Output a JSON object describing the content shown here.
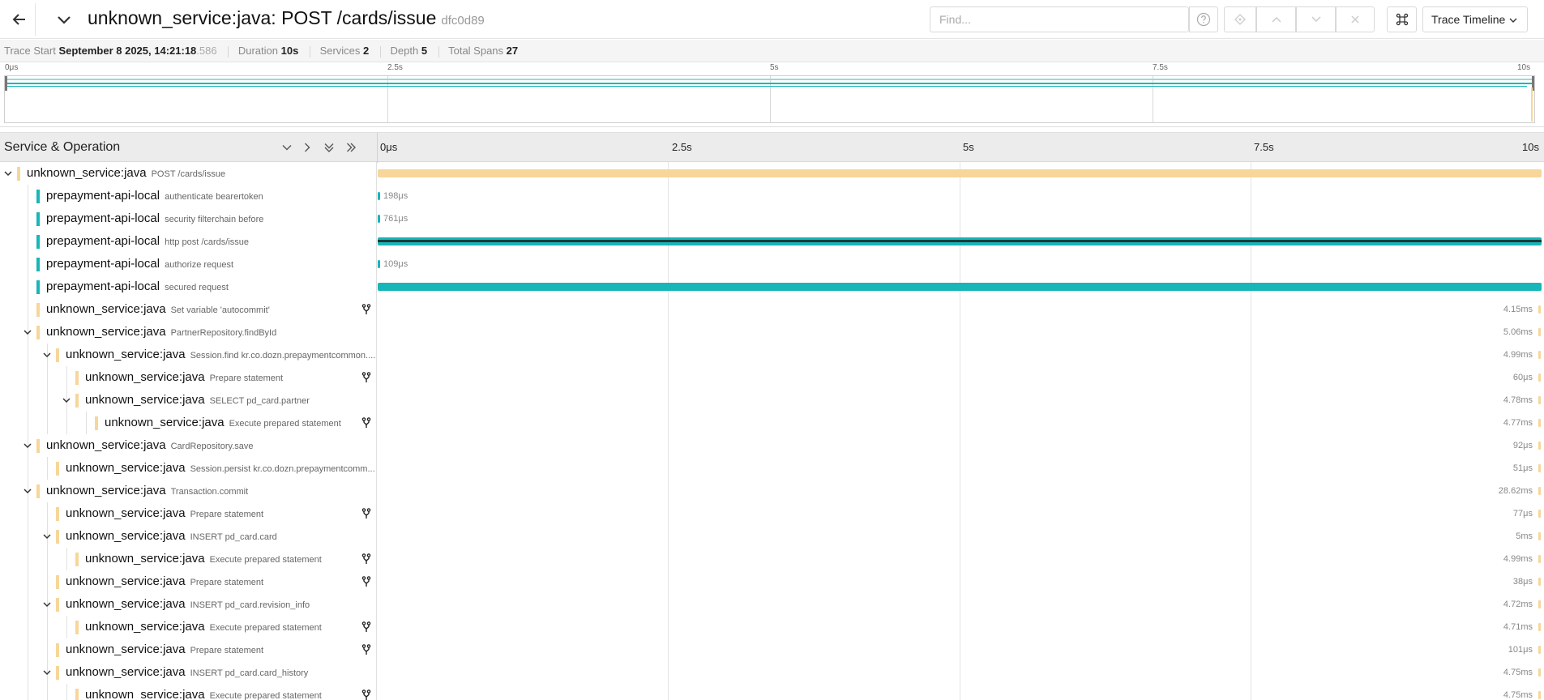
{
  "colors": {
    "java": "#f7d699",
    "prepay": "#17b6b8",
    "accent_dark": "#1e3a3a"
  },
  "header": {
    "title": "unknown_service:java: POST /cards/issue",
    "trace_id": "dfc0d89",
    "find_placeholder": "Find...",
    "view_label": "Trace Timeline",
    "icons": [
      "arrow-left-icon",
      "chevron-down-icon",
      "question-icon",
      "locate-icon",
      "arrow-up-icon",
      "arrow-down-icon",
      "close-icon",
      "command-icon"
    ]
  },
  "summary": {
    "trace_start_label": "Trace Start",
    "trace_start_value": "September 8 2025, 14:21:18",
    "trace_start_ms": ".586",
    "duration_label": "Duration",
    "duration_value": "10s",
    "services_label": "Services",
    "services_value": "2",
    "depth_label": "Depth",
    "depth_value": "5",
    "total_spans_label": "Total Spans",
    "total_spans_value": "27"
  },
  "minimap": {
    "ticks": [
      "0μs",
      "2.5s",
      "5s",
      "7.5s",
      "10s"
    ]
  },
  "timeline": {
    "column_title": "Service & Operation",
    "ticks": [
      "0μs",
      "2.5s",
      "5s",
      "7.5s",
      "10s"
    ]
  },
  "spans": [
    {
      "service": "unknown_service:java",
      "operation": "POST /cards/issue",
      "depth": 0,
      "expanded": true,
      "svc": "java",
      "bar": {
        "start": 0,
        "end": 1.0
      },
      "label": "",
      "fork": false
    },
    {
      "service": "prepayment-api-local",
      "operation": "authenticate bearertoken",
      "depth": 1,
      "expanded": null,
      "svc": "prepay",
      "bar": {
        "start": 0,
        "end": 0.0006
      },
      "label": "198μs",
      "fork": false
    },
    {
      "service": "prepayment-api-local",
      "operation": "security filterchain before",
      "depth": 1,
      "expanded": null,
      "svc": "prepay",
      "bar": {
        "start": 0,
        "end": 0.0006
      },
      "label": "761μs",
      "fork": false
    },
    {
      "service": "prepayment-api-local",
      "operation": "http post /cards/issue",
      "depth": 1,
      "expanded": null,
      "svc": "prepay",
      "bar": {
        "start": 0,
        "end": 1.0
      },
      "label": "",
      "fork": false,
      "dark_line": true
    },
    {
      "service": "prepayment-api-local",
      "operation": "authorize request",
      "depth": 1,
      "expanded": null,
      "svc": "prepay",
      "bar": {
        "start": 0,
        "end": 0.0006
      },
      "label": "109μs",
      "fork": false
    },
    {
      "service": "prepayment-api-local",
      "operation": "secured request",
      "depth": 1,
      "expanded": null,
      "svc": "prepay",
      "bar": {
        "start": 0,
        "end": 1.0
      },
      "label": "",
      "fork": false
    },
    {
      "service": "unknown_service:java",
      "operation": "Set variable 'autocommit'",
      "depth": 1,
      "expanded": null,
      "svc": "java",
      "bar": null,
      "label": "4.15ms",
      "fork": true
    },
    {
      "service": "unknown_service:java",
      "operation": "PartnerRepository.findById",
      "depth": 1,
      "expanded": true,
      "svc": "java",
      "bar": null,
      "label": "5.06ms",
      "fork": false
    },
    {
      "service": "unknown_service:java",
      "operation": "Session.find kr.co.dozn.prepaymentcommon....",
      "depth": 2,
      "expanded": true,
      "svc": "java",
      "bar": null,
      "label": "4.99ms",
      "fork": false
    },
    {
      "service": "unknown_service:java",
      "operation": "Prepare statement",
      "depth": 3,
      "expanded": null,
      "svc": "java",
      "bar": null,
      "label": "60μs",
      "fork": true
    },
    {
      "service": "unknown_service:java",
      "operation": "SELECT pd_card.partner",
      "depth": 3,
      "expanded": true,
      "svc": "java",
      "bar": null,
      "label": "4.78ms",
      "fork": false
    },
    {
      "service": "unknown_service:java",
      "operation": "Execute prepared statement",
      "depth": 4,
      "expanded": null,
      "svc": "java",
      "bar": null,
      "label": "4.77ms",
      "fork": true
    },
    {
      "service": "unknown_service:java",
      "operation": "CardRepository.save",
      "depth": 1,
      "expanded": true,
      "svc": "java",
      "bar": null,
      "label": "92μs",
      "fork": false
    },
    {
      "service": "unknown_service:java",
      "operation": "Session.persist kr.co.dozn.prepaymentcomm...",
      "depth": 2,
      "expanded": null,
      "svc": "java",
      "bar": null,
      "label": "51μs",
      "fork": false
    },
    {
      "service": "unknown_service:java",
      "operation": "Transaction.commit",
      "depth": 1,
      "expanded": true,
      "svc": "java",
      "bar": null,
      "label": "28.62ms",
      "fork": false
    },
    {
      "service": "unknown_service:java",
      "operation": "Prepare statement",
      "depth": 2,
      "expanded": null,
      "svc": "java",
      "bar": null,
      "label": "77μs",
      "fork": true
    },
    {
      "service": "unknown_service:java",
      "operation": "INSERT pd_card.card",
      "depth": 2,
      "expanded": true,
      "svc": "java",
      "bar": null,
      "label": "5ms",
      "fork": false
    },
    {
      "service": "unknown_service:java",
      "operation": "Execute prepared statement",
      "depth": 3,
      "expanded": null,
      "svc": "java",
      "bar": null,
      "label": "4.99ms",
      "fork": true
    },
    {
      "service": "unknown_service:java",
      "operation": "Prepare statement",
      "depth": 2,
      "expanded": null,
      "svc": "java",
      "bar": null,
      "label": "38μs",
      "fork": true
    },
    {
      "service": "unknown_service:java",
      "operation": "INSERT pd_card.revision_info",
      "depth": 2,
      "expanded": true,
      "svc": "java",
      "bar": null,
      "label": "4.72ms",
      "fork": false
    },
    {
      "service": "unknown_service:java",
      "operation": "Execute prepared statement",
      "depth": 3,
      "expanded": null,
      "svc": "java",
      "bar": null,
      "label": "4.71ms",
      "fork": true
    },
    {
      "service": "unknown_service:java",
      "operation": "Prepare statement",
      "depth": 2,
      "expanded": null,
      "svc": "java",
      "bar": null,
      "label": "101μs",
      "fork": true
    },
    {
      "service": "unknown_service:java",
      "operation": "INSERT pd_card.card_history",
      "depth": 2,
      "expanded": true,
      "svc": "java",
      "bar": null,
      "label": "4.75ms",
      "fork": false
    },
    {
      "service": "unknown_service:java",
      "operation": "Execute prepared statement",
      "depth": 3,
      "expanded": null,
      "svc": "java",
      "bar": null,
      "label": "4.75ms",
      "fork": true
    }
  ]
}
